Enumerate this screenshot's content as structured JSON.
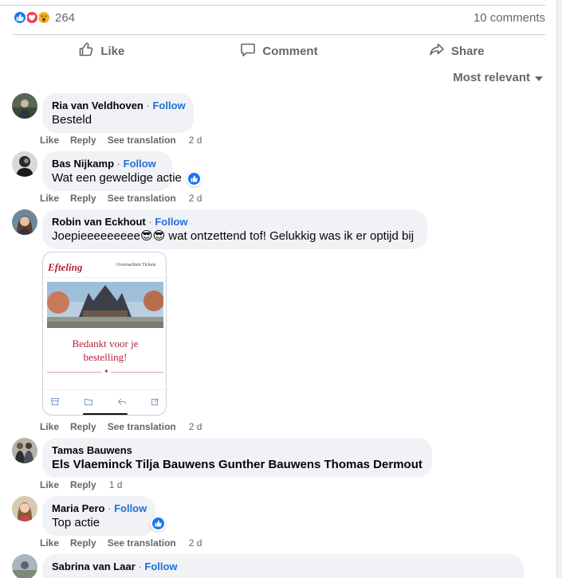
{
  "stats": {
    "reaction_icons": [
      "like-icon",
      "love-icon",
      "wow-icon"
    ],
    "reaction_count": "264",
    "comments_count": "10 comments"
  },
  "actions": {
    "like": "Like",
    "comment": "Comment",
    "share": "Share"
  },
  "sort_label": "Most relevant",
  "comment_actions": {
    "like": "Like",
    "reply": "Reply",
    "see_translation": "See translation",
    "follow": "Follow",
    "separator": "·"
  },
  "comments": [
    {
      "author": "Ria van Veldhoven",
      "text": "Besteld",
      "time": "2 d",
      "has_follow": true,
      "has_translation": true
    },
    {
      "author": "Bas Nijkamp",
      "text": "Wat een geweldige actie",
      "time": "2 d",
      "has_follow": true,
      "has_translation": true,
      "reaction": "like-icon"
    },
    {
      "author": "Robin van Eckhout",
      "text": "Joepieeeeeeeee😎😎 wat ontzettend tof! Gelukkig was ik er optijd bij",
      "time": "2 d",
      "has_follow": true,
      "has_translation": true,
      "attachment": "efteling-order-screenshot"
    },
    {
      "author": "Tamas Bauwens",
      "text": "Els Vlaeminck Tilja Bauwens Gunther Bauwens Thomas Dermout",
      "time": "1 d",
      "has_follow": false,
      "has_translation": false
    },
    {
      "author": "Maria Pero",
      "text": "Top actie",
      "time": "2 d",
      "has_follow": true,
      "has_translation": true,
      "reaction": "like-icon"
    },
    {
      "author": "Sabrina van Laar",
      "has_follow": true
    }
  ],
  "attachment": {
    "logo": "Efteling",
    "nav": "Overnachten   Tickets",
    "thanks_line1": "Bedankt voor je",
    "thanks_line2": "bestelling!"
  },
  "colors": {
    "link_blue": "#216fdb",
    "secondary_text": "#65676b",
    "bubble_bg": "#f0f2f5",
    "like_blue": "#1877f2",
    "love_red": "#f33e58",
    "wow_yellow": "#f7b125",
    "efteling_red": "#b21f3a"
  }
}
